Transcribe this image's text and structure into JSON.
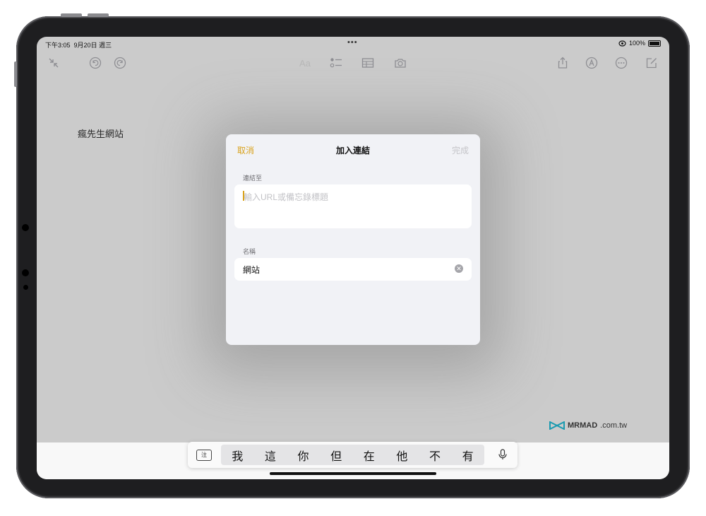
{
  "status_bar": {
    "time": "下午3:05",
    "date": "9月20日 週三",
    "battery": "100%"
  },
  "toolbar": {
    "left_icons": [
      "collapse-icon",
      "undo-icon",
      "redo-icon"
    ],
    "center_icons": [
      "format-icon",
      "checklist-icon",
      "table-icon",
      "camera-icon"
    ],
    "right_icons": [
      "share-icon",
      "markup-icon",
      "more-icon",
      "compose-icon"
    ],
    "format_label": "Aa"
  },
  "note": {
    "title": "瘋先生網站"
  },
  "dialog": {
    "cancel_label": "取消",
    "title": "加入連結",
    "done_label": "完成",
    "link_label": "連結至",
    "link_placeholder": "輸入URL或備忘錄標題",
    "name_label": "名稱",
    "name_value": "網站"
  },
  "watermark": {
    "brand": "MRMAD",
    "domain": ".com.tw"
  },
  "quicktype": {
    "keyboard_key": "注",
    "candidates": [
      "我",
      "這",
      "你",
      "但",
      "在",
      "他",
      "不",
      "有"
    ]
  },
  "colors": {
    "accent": "#d9a21b",
    "disabled": "#c4c4c8",
    "dim_background": "#cbcbcb"
  }
}
